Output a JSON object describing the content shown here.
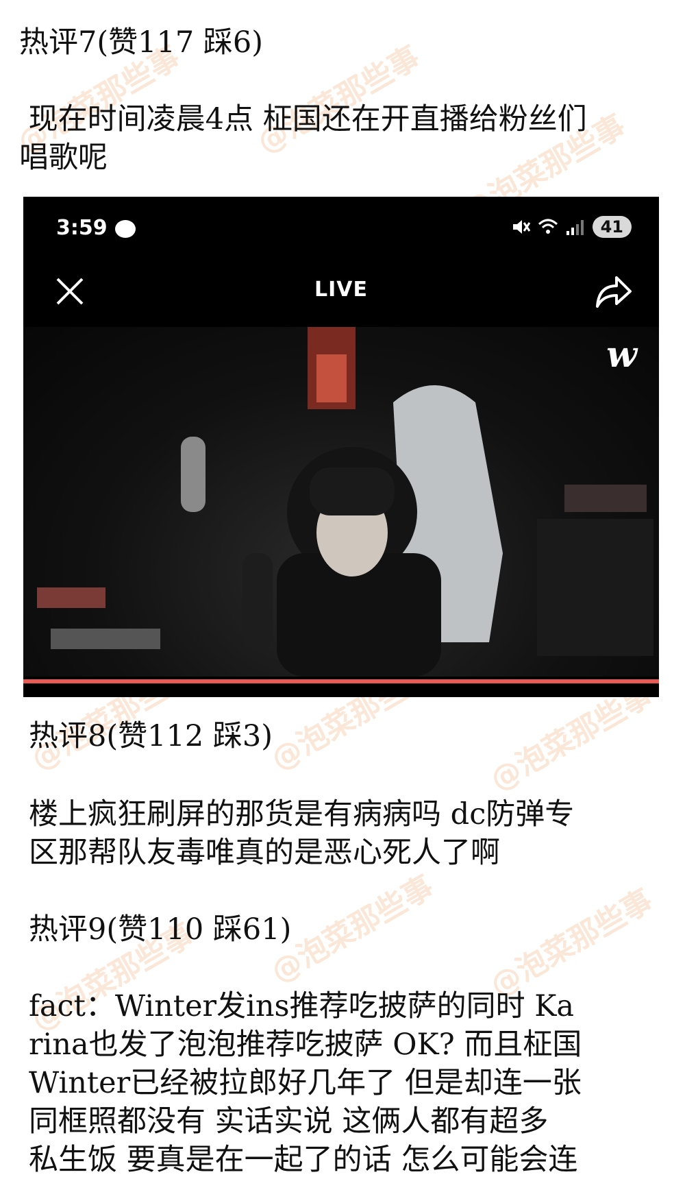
{
  "comments": [
    {
      "header": "热评7(赞117 踩6)",
      "body_lines": [
        " 现在时间凌晨4点 柾国还在开直播给粉丝们",
        "唱歌呢"
      ]
    },
    {
      "header": "热评8(赞112 踩3)",
      "body_lines": [
        "楼上疯狂刷屏的那货是有病病吗 dc防弹专",
        "区那帮队友毒唯真的是恶心死人了啊"
      ]
    },
    {
      "header": "热评9(赞110 踩61)",
      "body_lines": [
        "fact：Winter发ins推荐吃披萨的同时 Ka",
        "rina也发了泡泡推荐吃披萨 OK? 而且柾国",
        "Winter已经被拉郎好几年了 但是却连一张",
        "同框照都没有 实话实说 这俩人都有超多",
        "私生饭 要真是在一起了的话 怎么可能会连"
      ]
    }
  ],
  "watermark": "@泡菜那些事",
  "screenshot": {
    "time": "3:59",
    "battery": "41",
    "title": "LIVE",
    "w_logo": "w",
    "progress_color": "#e85b54"
  }
}
